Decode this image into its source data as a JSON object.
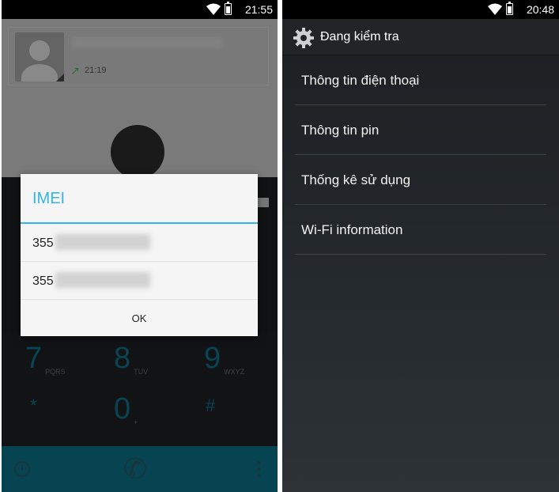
{
  "left_screen": {
    "status_time": "21:55",
    "contact_call_time": "21:19",
    "dialog": {
      "title": "IMEI",
      "rows": [
        "355",
        "355"
      ],
      "ok_label": "OK"
    },
    "keys": [
      {
        "num": "7",
        "letters": "PQRS"
      },
      {
        "num": "8",
        "letters": "TUV"
      },
      {
        "num": "9",
        "letters": "WXYZ"
      },
      {
        "num": "*",
        "letters": ""
      },
      {
        "num": "0",
        "letters": "+"
      },
      {
        "num": "#",
        "letters": ""
      }
    ],
    "accent_color": "#33b5e5"
  },
  "right_screen": {
    "status_time": "20:48",
    "title": "Đang kiểm tra",
    "items": [
      "Thông tin điện thoại",
      "Thông tin pin",
      "Thống kê sử dụng",
      "Wi-Fi information"
    ]
  }
}
